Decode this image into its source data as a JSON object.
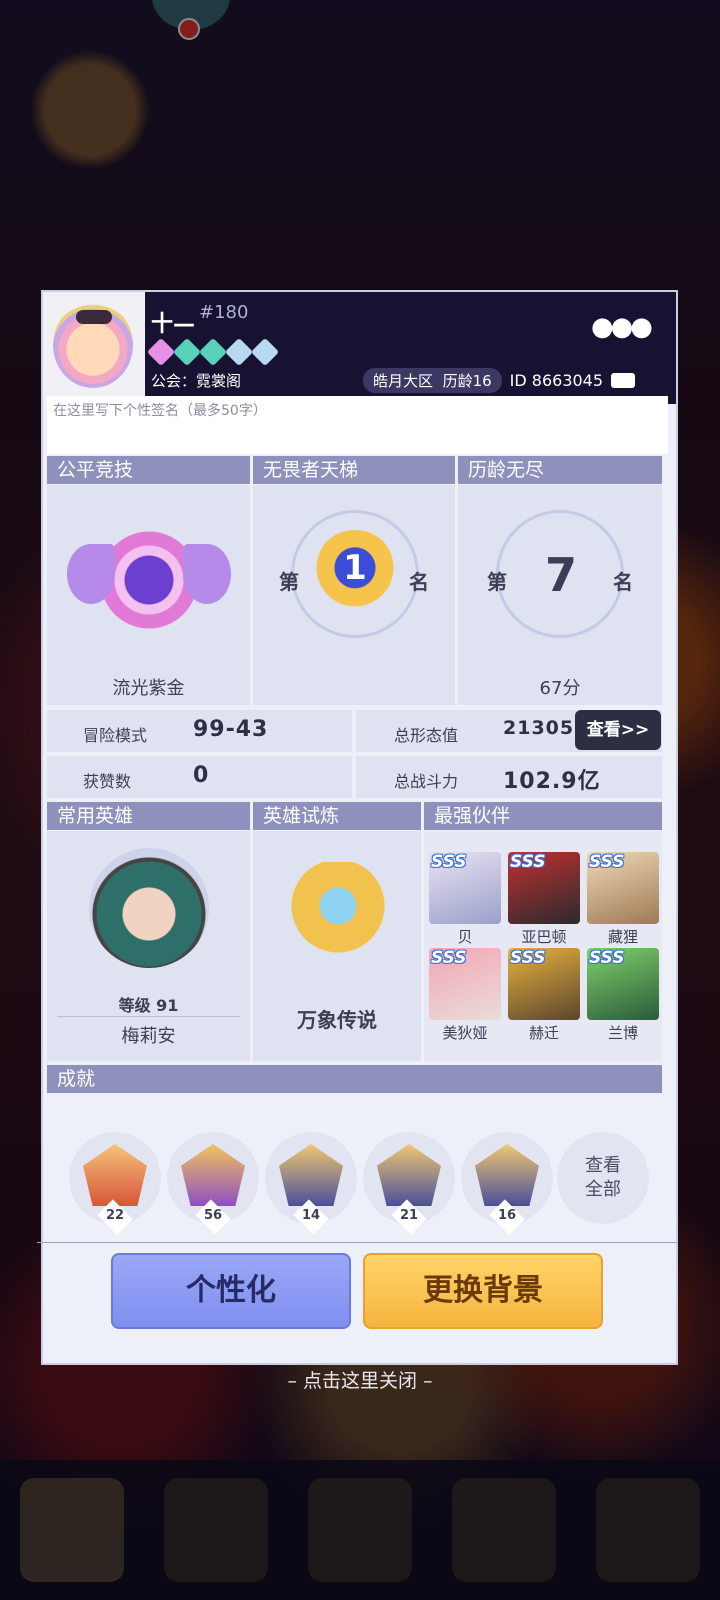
{
  "profile": {
    "name": "十—",
    "rank_number": "#180",
    "guild": "公会：霓裳阁",
    "server": "皓月大区",
    "age": "历龄16",
    "uid": "ID 8663045",
    "signature_placeholder": "在这里写下个性签名（最多50字）",
    "gem_colors": [
      "#e690e6",
      "#57d1b8",
      "#57d1b8",
      "#b9d9f2",
      "#b9d9f2"
    ]
  },
  "sections": {
    "fair": {
      "title": "公平竞技",
      "label": "流光紫金"
    },
    "ladder": {
      "title": "无畏者天梯",
      "prefix": "第",
      "rank": "1",
      "suffix": "名"
    },
    "endless": {
      "title": "历龄无尽",
      "prefix": "第",
      "rank": "7",
      "suffix": "名",
      "score": "67分"
    }
  },
  "stats": {
    "adventure_label": "冒险模式",
    "adventure_value": "99-43",
    "likes_label": "获赞数",
    "likes_value": "0",
    "form_label": "总形态值",
    "form_value": "213057",
    "power_label": "总战斗力",
    "power_value": "102.9亿",
    "view_button": "查看>>"
  },
  "hero": {
    "title": "常用英雄",
    "level": "等级 91",
    "name": "梅莉安"
  },
  "trial": {
    "title": "英雄试炼",
    "label": "万象传说"
  },
  "partners": {
    "title": "最强伙伴",
    "items": [
      {
        "name": "贝",
        "tier": "SSS"
      },
      {
        "name": "亚巴顿",
        "tier": "SSS"
      },
      {
        "name": "藏狸",
        "tier": "SSS"
      },
      {
        "name": "美狄娅",
        "tier": "SSS"
      },
      {
        "name": "赫迁",
        "tier": "SSS"
      },
      {
        "name": "兰博",
        "tier": "SSS"
      }
    ]
  },
  "achievements": {
    "title": "成就",
    "counts": [
      "22",
      "56",
      "14",
      "21",
      "16"
    ],
    "view_all": "查看\n全部"
  },
  "buttons": {
    "personalize": "个性化",
    "change_bg": "更换背景"
  },
  "close_hint": "– 点击这里关闭 –"
}
